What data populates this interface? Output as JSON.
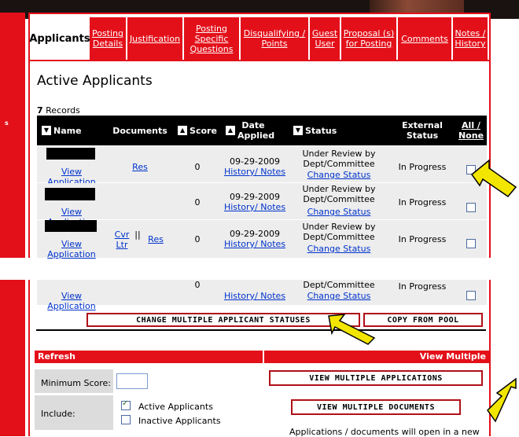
{
  "tabs": [
    {
      "label": "Applicants"
    },
    {
      "label": "Posting Details"
    },
    {
      "label": "Justification"
    },
    {
      "label": "Posting Specific Questions"
    },
    {
      "label": "Disqualifying / Points"
    },
    {
      "label": "Guest User"
    },
    {
      "label": "Proposal (s) for Posting"
    },
    {
      "label": "Comments"
    },
    {
      "label": "Notes / History"
    }
  ],
  "heading": "Active Applicants",
  "records": {
    "count": "7",
    "label": " Records"
  },
  "table": {
    "headers": {
      "name": "Name",
      "documents": "Documents",
      "score": "Score",
      "date": "Date Applied",
      "status": "Status",
      "external": "External Status",
      "all_none": "All / None"
    },
    "rows": [
      {
        "link": "View Application",
        "doc1": "Res",
        "doc2": "",
        "score": "0",
        "date": "09-29-2009",
        "history": "History/ Notes",
        "status": "Under Review by Dept/Committee",
        "change": "Change Status",
        "external": "In Progress"
      },
      {
        "link": "View Application",
        "doc1": "",
        "doc2": "",
        "score": "0",
        "date": "09-29-2009",
        "history": "History/ Notes",
        "status": "Under Review by Dept/Committee",
        "change": "Change Status",
        "external": "In Progress"
      },
      {
        "link": "View Application",
        "doc1": "Cvr Ltr",
        "sep": "||",
        "doc2": "Res",
        "score": "0",
        "date": "09-29-2009",
        "history": "History/ Notes",
        "status": "Under Review by Dept/Committee",
        "change": "Change Status",
        "external": "In Progress"
      },
      {
        "link": "View Application",
        "doc1": "",
        "doc2": "",
        "score": "0",
        "date": "",
        "history": "History/ Notes",
        "status": "Dept/Committee",
        "change": "Change Status",
        "external": "In Progress"
      }
    ]
  },
  "actions": {
    "change_multiple": "CHANGE MULTIPLE APPLICANT STATUSES",
    "copy_pool": "COPY FROM POOL"
  },
  "refresh_panel": {
    "title": "Refresh",
    "min_score_label": "Minimum Score:",
    "min_score_value": "",
    "include_label": "Include:",
    "active_label": "Active Applicants",
    "inactive_label": "Inactive Applicants",
    "active_checked": true,
    "inactive_checked": false
  },
  "view_panel": {
    "title": "View Multiple",
    "view_apps": "VIEW MULTIPLE APPLICATIONS",
    "view_docs": "VIEW MULTIPLE DOCUMENTS",
    "note": "Applications / documents will open in a new"
  },
  "colors": {
    "accent": "#e3101a",
    "arrow": "#f2e600",
    "link": "#0033cc"
  }
}
